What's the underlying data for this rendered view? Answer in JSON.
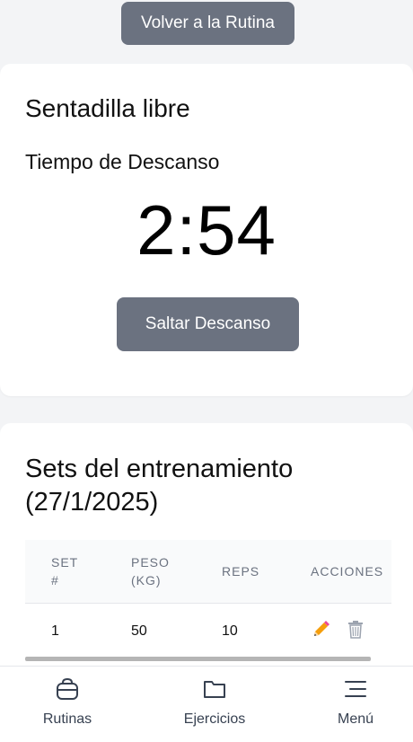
{
  "back_button": {
    "label": "Volver a la Rutina"
  },
  "rest": {
    "exercise_name": "Sentadilla libre",
    "label": "Tiempo de Descanso",
    "timer": "2:54",
    "skip_label": "Saltar Descanso"
  },
  "sets": {
    "title": "Sets del entrenamiento (27/1/2025)",
    "columns": [
      "SET #",
      "PESO (KG)",
      "REPS",
      "ACCIONES"
    ],
    "rows": [
      {
        "set": "1",
        "weight": "50",
        "reps": "10"
      }
    ],
    "action_icons": [
      "pencil-icon",
      "trash-icon"
    ]
  },
  "nav": {
    "items": [
      {
        "label": "Rutinas",
        "icon": "weight-icon"
      },
      {
        "label": "Ejercicios",
        "icon": "folder-icon"
      },
      {
        "label": "Menú",
        "icon": "menu-icon"
      }
    ]
  },
  "colors": {
    "button_gray": "#6b7280",
    "background": "#f3f4f6",
    "pencil": "#f59e0b",
    "trash": "#9ca3af"
  }
}
